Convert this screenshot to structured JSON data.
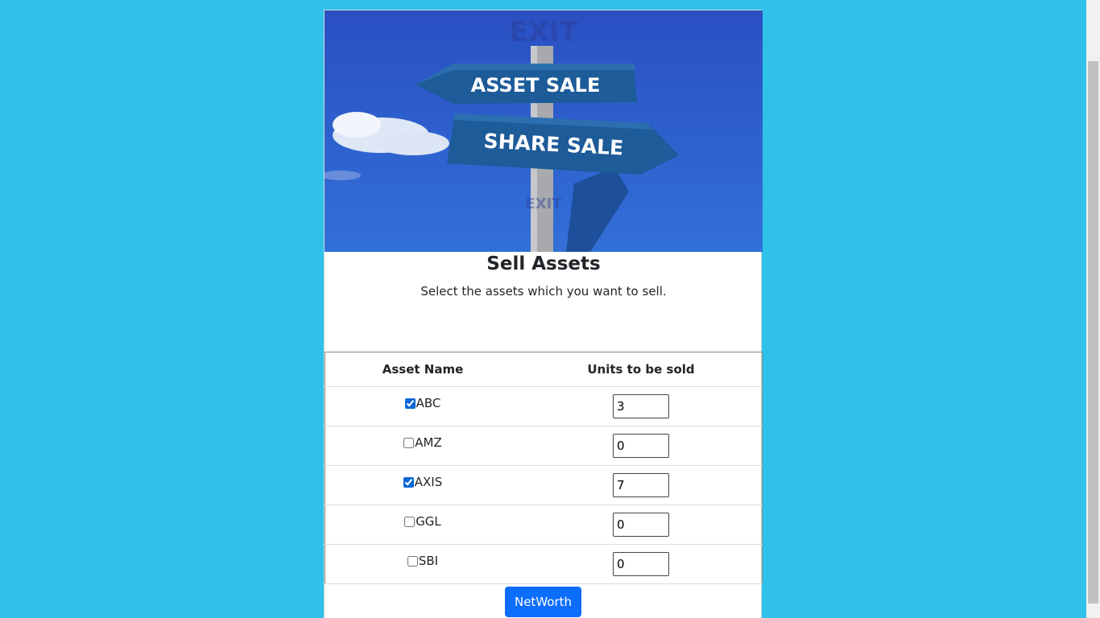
{
  "hero": {
    "sign_top": "ASSET SALE",
    "sign_bottom": "SHARE SALE",
    "watermark": "EXIT"
  },
  "page": {
    "title": "Sell Assets",
    "subtitle": "Select the assets which you want to sell."
  },
  "table": {
    "headers": [
      "Asset Name",
      "Units to be sold"
    ],
    "rows": [
      {
        "name": "ABC",
        "checked": true,
        "units": "3"
      },
      {
        "name": "AMZ",
        "checked": false,
        "units": "0"
      },
      {
        "name": "AXIS",
        "checked": true,
        "units": "7"
      },
      {
        "name": "GGL",
        "checked": false,
        "units": "0"
      },
      {
        "name": "SBI",
        "checked": false,
        "units": "0"
      }
    ]
  },
  "actions": {
    "networth_label": "NetWorth"
  },
  "colors": {
    "background": "#30c1eb",
    "button": "#0d6efd"
  }
}
